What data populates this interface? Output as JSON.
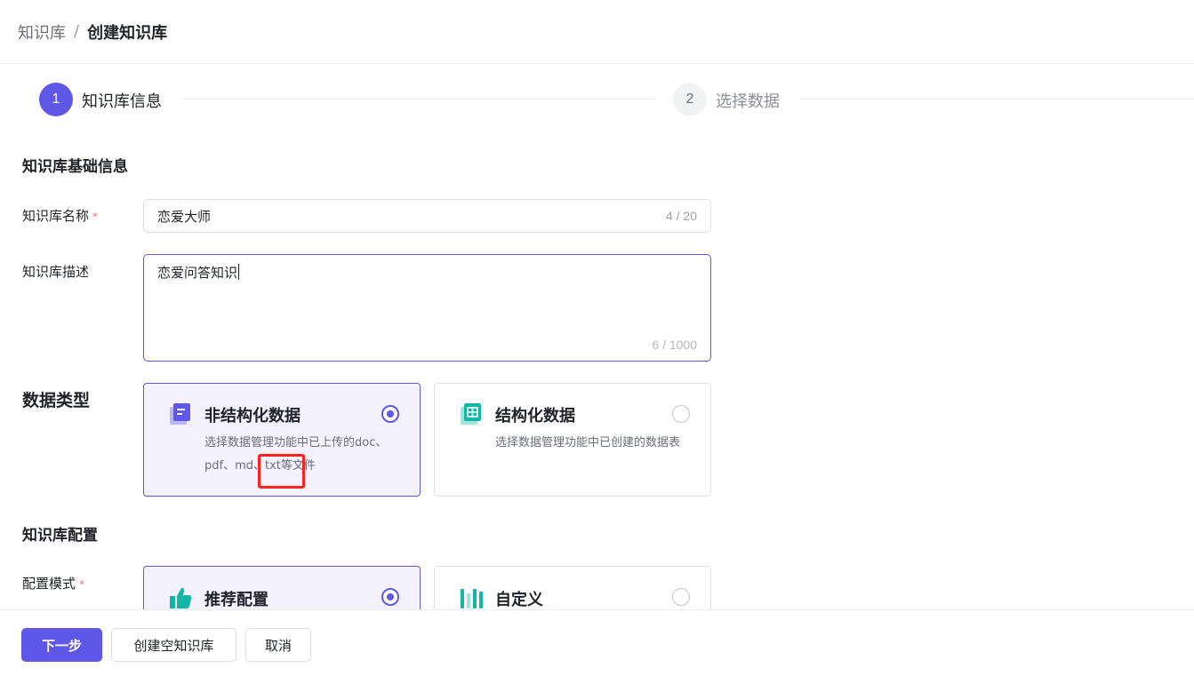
{
  "breadcrumb": {
    "parent": "知识库",
    "separator": "/",
    "current": "创建知识库"
  },
  "steps": [
    {
      "number": "1",
      "label": "知识库信息",
      "status": "active"
    },
    {
      "number": "2",
      "label": "选择数据",
      "status": "pending"
    }
  ],
  "basic_section": {
    "title": "知识库基础信息"
  },
  "name_field": {
    "label": "知识库名称",
    "required_mark": "*",
    "value": "恋爱大师",
    "counter": "4 / 20"
  },
  "desc_field": {
    "label": "知识库描述",
    "value": "恋爱问答知识",
    "counter": "6 / 1000"
  },
  "data_type": {
    "label": "数据类型",
    "options": [
      {
        "title": "非结构化数据",
        "desc": "选择数据管理功能中已上传的doc、pdf、md、txt等文件",
        "selected": true,
        "icon": "document-icon"
      },
      {
        "title": "结构化数据",
        "desc": "选择数据管理功能中已创建的数据表",
        "selected": false,
        "icon": "table-icon"
      }
    ]
  },
  "config_section": {
    "title": "知识库配置"
  },
  "config_mode": {
    "label": "配置模式",
    "required_mark": "*",
    "options": [
      {
        "title": "推荐配置",
        "selected": true,
        "icon": "thumbs-up-icon"
      },
      {
        "title": "自定义",
        "selected": false,
        "icon": "sliders-icon"
      }
    ]
  },
  "footer": {
    "next": "下一步",
    "create_empty": "创建空知识库",
    "cancel": "取消"
  },
  "colors": {
    "accent": "#5f57e8",
    "required": "#f56c6c",
    "highlight": "#ff2020",
    "structured_icon": "#13b5a4"
  }
}
